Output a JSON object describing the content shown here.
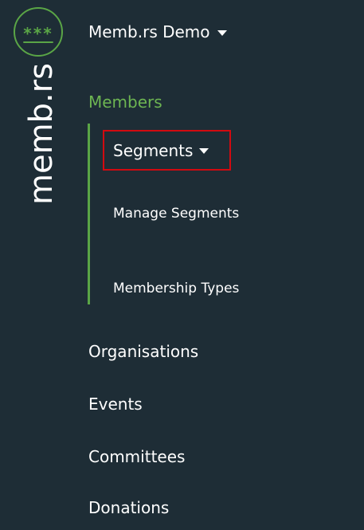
{
  "logo": {
    "stars": "***",
    "wordmark": "memb.rs"
  },
  "org_switcher": {
    "label": "Memb.rs Demo"
  },
  "nav": {
    "members_label": "Members",
    "segments_label": "Segments",
    "submenu": [
      {
        "label": "Manage Segments"
      },
      {
        "label": "Membership Types"
      }
    ],
    "items": [
      {
        "label": "Organisations"
      },
      {
        "label": "Events"
      },
      {
        "label": "Committees"
      },
      {
        "label": "Donations"
      }
    ]
  },
  "colors": {
    "background": "#1e2d36",
    "accent_green": "#5aa546",
    "highlight_red": "#d20a10",
    "text": "#ffffff"
  }
}
